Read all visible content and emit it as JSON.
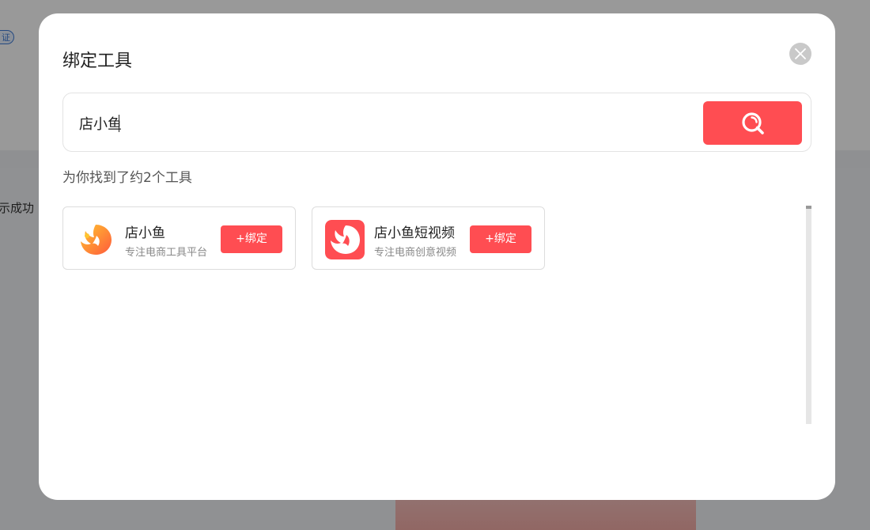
{
  "background": {
    "badge": "证",
    "status_text": "示成功"
  },
  "modal": {
    "title": "绑定工具",
    "search": {
      "value": "店小鱼",
      "placeholder": ""
    },
    "result_count": "为你找到了约2个工具",
    "results": [
      {
        "name": "店小鱼",
        "description": "专注电商工具平台",
        "bind_label": "+绑定",
        "logo": "dianxiaoyu-logo"
      },
      {
        "name": "店小鱼短视频",
        "description": "专注电商创意视频",
        "bind_label": "+绑定",
        "logo": "dianxiaoyu-video-logo"
      }
    ]
  },
  "colors": {
    "accent": "#ff4d52",
    "overlay": "rgba(0,0,0,0.4)"
  }
}
